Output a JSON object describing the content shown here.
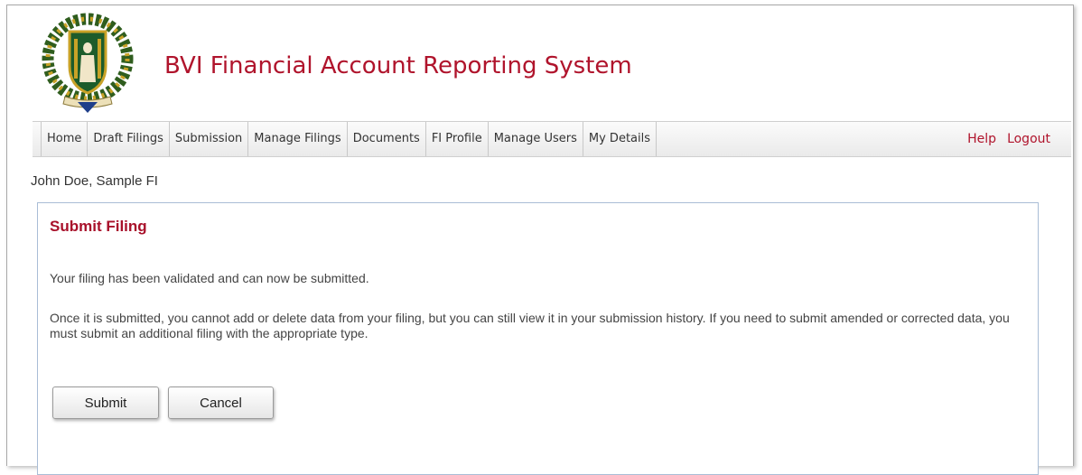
{
  "header": {
    "title": "BVI Financial Account Reporting System",
    "logo_icon": "bvi-coat-of-arms-icon"
  },
  "nav": {
    "items": [
      {
        "label": "Home"
      },
      {
        "label": "Draft Filings"
      },
      {
        "label": "Submission"
      },
      {
        "label": "Manage Filings"
      },
      {
        "label": "Documents"
      },
      {
        "label": "FI Profile"
      },
      {
        "label": "Manage Users"
      },
      {
        "label": "My Details"
      }
    ],
    "help_label": "Help",
    "logout_label": "Logout"
  },
  "user": {
    "name": "John Doe, Sample FI"
  },
  "panel": {
    "title": "Submit Filing",
    "message_validated": "Your filing has been validated and can now be submitted.",
    "message_info": "Once it is submitted, you cannot add or delete data from your filing, but you can still view it in your submission history. If you need to submit amended or corrected data, you must submit an additional filing with the appropriate type.",
    "submit_label": "Submit",
    "cancel_label": "Cancel"
  },
  "colors": {
    "brand_red": "#b0142c",
    "panel_border": "#a9bdd6"
  }
}
